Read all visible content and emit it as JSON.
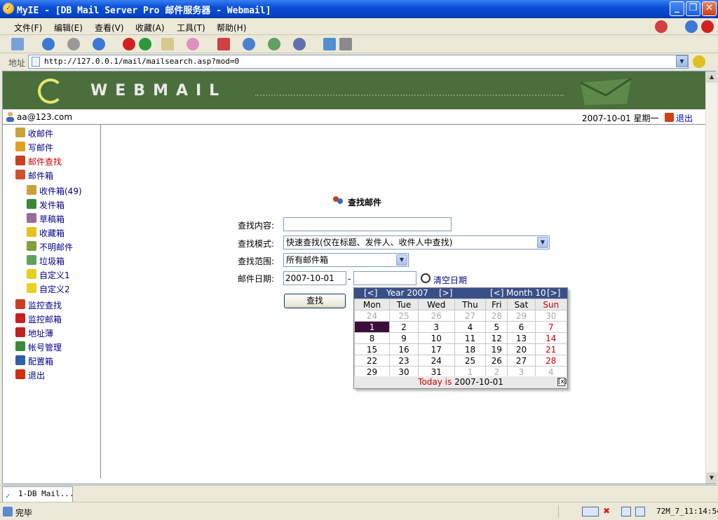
{
  "window": {
    "title": "MyIE - [DB Mail Server Pro 邮件服务器 - Webmail]"
  },
  "menu": [
    "文件(F)",
    "编辑(E)",
    "查看(V)",
    "收藏(A)",
    "工具(T)",
    "帮助(H)"
  ],
  "address": {
    "label": "地址",
    "url": "http://127.0.0.1/mail/mailsearch.asp?mod=0"
  },
  "banner": {
    "wordmark": "WEBMAIL"
  },
  "user": {
    "email": "aa@123.com",
    "date": "2007-10-01 星期一",
    "logout": "退出"
  },
  "sidebar": {
    "items": [
      {
        "label": "收邮件",
        "icon": "inbox-icon",
        "color": "#caa23a"
      },
      {
        "label": "写邮件",
        "icon": "pencil-icon",
        "color": "#e0a020"
      },
      {
        "label": "邮件查找",
        "icon": "search-people-icon",
        "color": "#c84020",
        "active": true
      },
      {
        "label": "邮件箱",
        "icon": "house-icon",
        "color": "#d05030"
      },
      {
        "label": "收件箱(49)",
        "icon": "inbox-folder-icon",
        "color": "#caa23a",
        "indent": true
      },
      {
        "label": "发件箱",
        "icon": "outbox-folder-icon",
        "color": "#3a8a3a",
        "indent": true
      },
      {
        "label": "草稿箱",
        "icon": "drafts-icon",
        "color": "#9a6a9a",
        "indent": true
      },
      {
        "label": "收藏箱",
        "icon": "star-icon",
        "color": "#e8c020",
        "indent": true
      },
      {
        "label": "不明邮件",
        "icon": "unknown-mail-icon",
        "color": "#80a040",
        "indent": true
      },
      {
        "label": "垃圾箱",
        "icon": "trash-icon",
        "color": "#60a060",
        "indent": true
      },
      {
        "label": "自定义1",
        "icon": "custom-folder-icon",
        "color": "#e8d020",
        "indent": true
      },
      {
        "label": "自定义2",
        "icon": "custom-folder-icon",
        "color": "#e8d020",
        "indent": true
      },
      {
        "label": "监控查找",
        "icon": "monitor-search-icon",
        "color": "#c84020"
      },
      {
        "label": "监控邮箱",
        "icon": "monitor-mailbox-icon",
        "color": "#c82020"
      },
      {
        "label": "地址薄",
        "icon": "address-book-icon",
        "color": "#c02020"
      },
      {
        "label": "帐号管理",
        "icon": "account-icon",
        "color": "#3a8a3a"
      },
      {
        "label": "配置箱",
        "icon": "config-icon",
        "color": "#3060a0"
      },
      {
        "label": "退出",
        "icon": "exit-icon",
        "color": "#d03010"
      }
    ]
  },
  "form": {
    "title": "查找邮件",
    "content_label": "查找内容:",
    "content_value": "",
    "mode_label": "查找模式:",
    "mode_value": "快速查找(仅在标题、发件人、收件人中查找)",
    "scope_label": "查找范围:",
    "scope_value": "所有邮件箱",
    "date_label": "邮件日期:",
    "date_from": "2007-10-01",
    "date_sep": "-",
    "date_to": "",
    "clear_date": "清空日期",
    "search_button": "查找"
  },
  "calendar": {
    "prev_year": "[<]",
    "year_label": "Year 2007",
    "next_year": "[>]",
    "prev_month": "[<]",
    "month_label": "Month 10",
    "next_month": "[>]",
    "weekdays": [
      "Mon",
      "Tue",
      "Wed",
      "Thu",
      "Fri",
      "Sat",
      "Sun"
    ],
    "weeks": [
      [
        "24",
        "25",
        "26",
        "27",
        "28",
        "29",
        "30"
      ],
      [
        "1",
        "2",
        "3",
        "4",
        "5",
        "6",
        "7"
      ],
      [
        "8",
        "9",
        "10",
        "11",
        "12",
        "13",
        "14"
      ],
      [
        "15",
        "16",
        "17",
        "18",
        "19",
        "20",
        "21"
      ],
      [
        "22",
        "23",
        "24",
        "25",
        "26",
        "27",
        "28"
      ],
      [
        "29",
        "30",
        "31",
        "1",
        "2",
        "3",
        "4"
      ]
    ],
    "today_label": "Today is",
    "today_value": "2007-10-01",
    "close": "[x]"
  },
  "tabs": [
    {
      "label": "1-DB Mail..."
    }
  ],
  "status": {
    "text": "完毕",
    "clock": "72M_7_11:14:54"
  }
}
